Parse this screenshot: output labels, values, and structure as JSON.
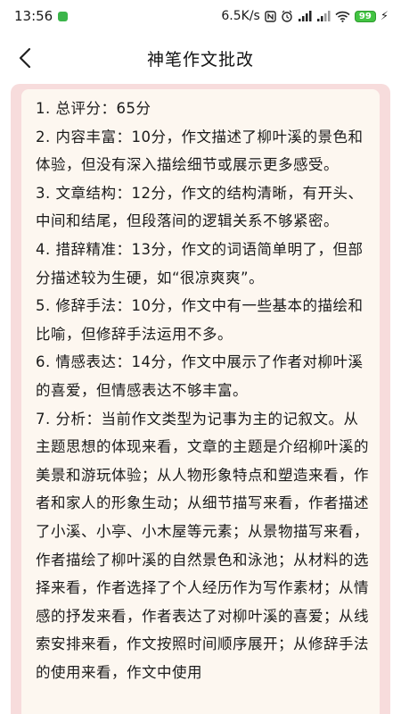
{
  "status_bar": {
    "time": "13:56",
    "network_speed": "6.5K/s",
    "icons": [
      "nfc-icon",
      "alarm-icon",
      "signal-hd-icon",
      "signal-hd-icon-2",
      "wifi-icon"
    ],
    "battery_level": "99",
    "accent_green": "#43c443"
  },
  "nav": {
    "back_icon": "chevron-left-icon",
    "title": "神笔作文批改"
  },
  "colors": {
    "card_border": "#f7dcdc",
    "card_background": "#fdf7f0"
  },
  "review": {
    "items": [
      "1. 总评分：65分",
      "2. 内容丰富：10分，作文描述了柳叶溪的景色和体验，但没有深入描绘细节或展示更多感受。",
      "3. 文章结构：12分，作文的结构清晰，有开头、中间和结尾，但段落间的逻辑关系不够紧密。",
      "4. 措辞精准：13分，作文的词语简单明了，但部分描述较为生硬，如“很凉爽爽”。",
      "5. 修辞手法：10分，作文中有一些基本的描绘和比喻，但修辞手法运用不多。",
      "6. 情感表达：14分，作文中展示了作者对柳叶溪的喜爱，但情感表达不够丰富。",
      "7. 分析：当前作文类型为记事为主的记叙文。从主题思想的体现来看，文章的主题是介绍柳叶溪的美景和游玩体验；从人物形象特点和塑造来看，作者和家人的形象生动；从细节描写来看，作者描述了小溪、小亭、小木屋等元素；从景物描写来看，作者描绘了柳叶溪的自然景色和泳池；从材料的选择来看，作者选择了个人经历作为写作素材；从情感的抒发来看，作者表达了对柳叶溪的喜爱；从线索安排来看，作文按照时间顺序展开；从修辞手法的使用来看，作文中使用"
    ]
  }
}
